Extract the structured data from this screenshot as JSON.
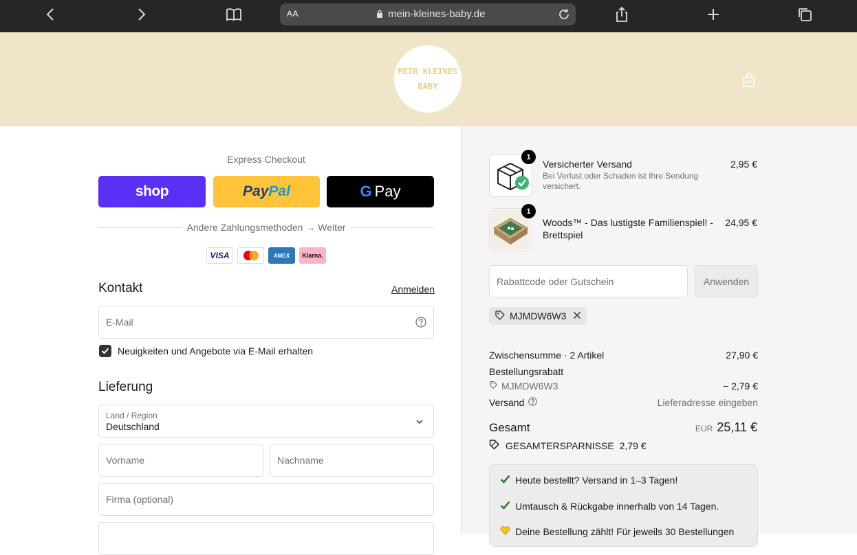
{
  "browser": {
    "text_size_label": "AA",
    "url": "mein-kleines-baby.de"
  },
  "header": {
    "logo_line1": "MEIN KLEINES",
    "logo_line2": "BABY"
  },
  "express": {
    "title": "Express Checkout",
    "shop_label": "shop",
    "paypal_label_1": "Pay",
    "paypal_label_2": "Pal",
    "gpay_g": "G",
    "gpay_label": "Pay",
    "divider_text": "Andere Zahlungsmethoden → Weiter",
    "cards": [
      "VISA",
      "",
      "AMEX",
      "Klarna."
    ]
  },
  "contact": {
    "title": "Kontakt",
    "login_label": "Anmelden",
    "email_placeholder": "E-Mail",
    "newsletter_label": "Neuigkeiten und Angebote via E-Mail erhalten",
    "newsletter_checked": true
  },
  "delivery": {
    "title": "Lieferung",
    "country_label": "Land / Region",
    "country_value": "Deutschland",
    "first_name_placeholder": "Vorname",
    "last_name_placeholder": "Nachname",
    "company_placeholder": "Firma (optional)"
  },
  "order": {
    "items": [
      {
        "name": "Versicherter Versand",
        "sub": "Bei Verlust oder Schaden ist Ihre Sendung versichert.",
        "price": "2,95 €",
        "qty": "1",
        "icon": "insured-shipping-box-icon"
      },
      {
        "name": "Woods™ - Das lustigste Familienspiel! - Brettspiel",
        "sub": "",
        "price": "24,95 €",
        "qty": "1",
        "icon": "board-game-thumbnail"
      }
    ],
    "discount_placeholder": "Rabattcode oder Gutschein",
    "apply_label": "Anwenden",
    "applied_code": "MJMDW6W3",
    "subtotal_label": "Zwischensumme · 2 Artikel",
    "subtotal_value": "27,90 €",
    "order_discount_label": "Bestellungsrabatt",
    "order_discount_code": "MJMDW6W3",
    "order_discount_value": "− 2,79 €",
    "shipping_label": "Versand",
    "shipping_value": "Lieferadresse eingeben",
    "total_label": "Gesamt",
    "total_currency": "EUR",
    "total_value": "25,11 €",
    "savings_label": "GESAMTERSPARNISSE",
    "savings_value": "2,79 €"
  },
  "trust": {
    "items": [
      "Heute bestellt? Versand in 1–3 Tagen!",
      "Umtausch & Rückgabe innerhalb von 14 Tagen.",
      "Deine Bestellung zählt! Für jeweils 30 Bestellungen"
    ]
  },
  "colors": {
    "banner": "#f0e4c9",
    "shop_purple": "#5a31f4",
    "paypal_yellow": "#ffc439",
    "check_green": "#2e7d32"
  }
}
